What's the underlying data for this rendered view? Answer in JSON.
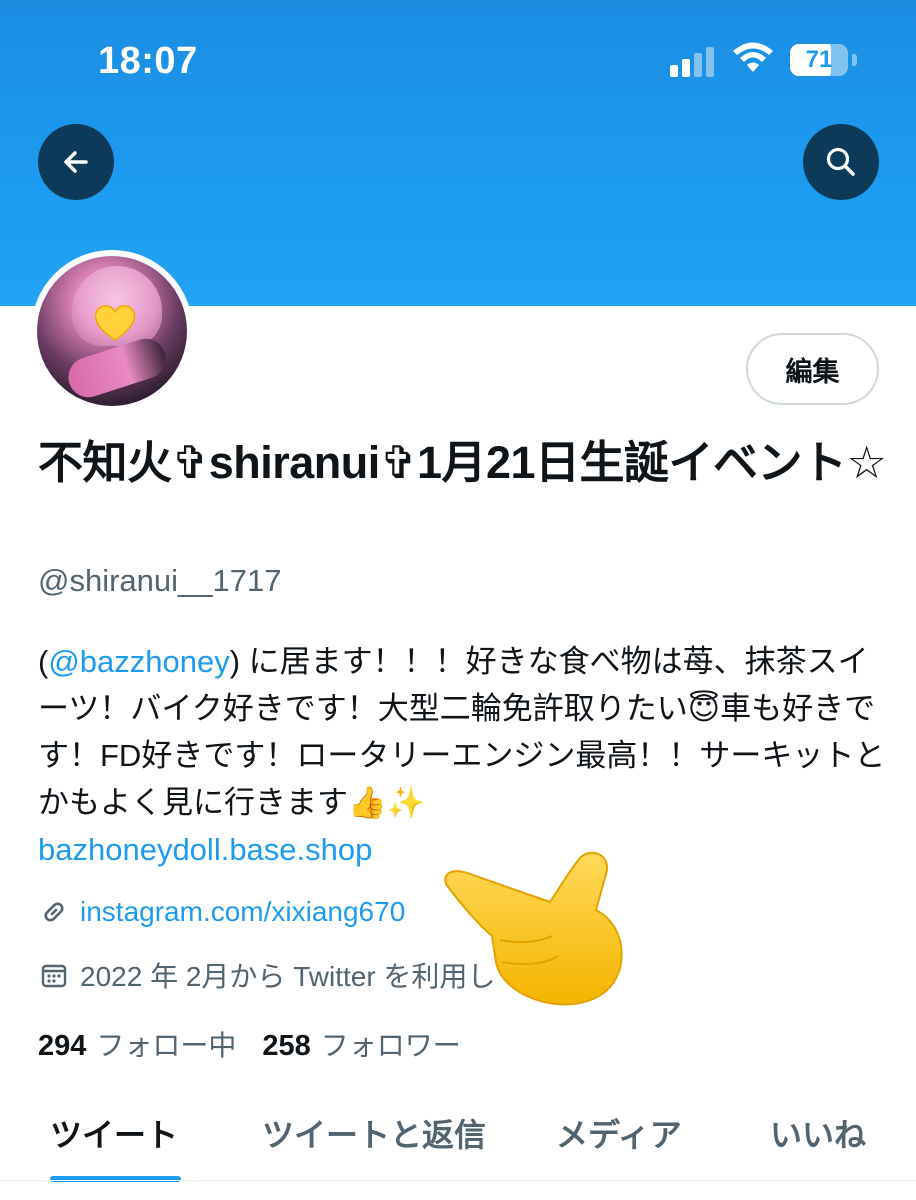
{
  "status_bar": {
    "time": "18:07",
    "battery": "71",
    "battery_level_percent": 71
  },
  "header": {
    "back_icon": "arrow-left-icon",
    "search_icon": "search-icon"
  },
  "profile": {
    "edit_label": "編集",
    "display_name": "不知火✞shiranui✞1月21日生誕イベント☆",
    "handle": "@shiranui__1717",
    "bio_open": "(",
    "bio_mention": "@bazzhoney",
    "bio_text": ") に居ます！！！好きな食べ物は苺、抹茶スイーツ！バイク好きです！大型二輪免許取りたい😇車も好きです！FD好きです！ロータリーエンジン最高！！サーキットとかもよく見に行きます👍✨",
    "bio_link": "bazhoneydoll.base.shop",
    "website": "instagram.com/xixiang670",
    "joined": "2022 年 2月から Twitter を利用しています",
    "following_count": "294",
    "following_label": "フォロー中",
    "followers_count": "258",
    "followers_label": "フォロワー"
  },
  "tabs": [
    {
      "label": "ツイート"
    },
    {
      "label": "ツイートと返信"
    },
    {
      "label": "メディア"
    },
    {
      "label": "いいね"
    }
  ],
  "colors": {
    "accent": "#1d9bf0",
    "header_button": "#0e3a5a",
    "secondary_text": "#536471"
  }
}
